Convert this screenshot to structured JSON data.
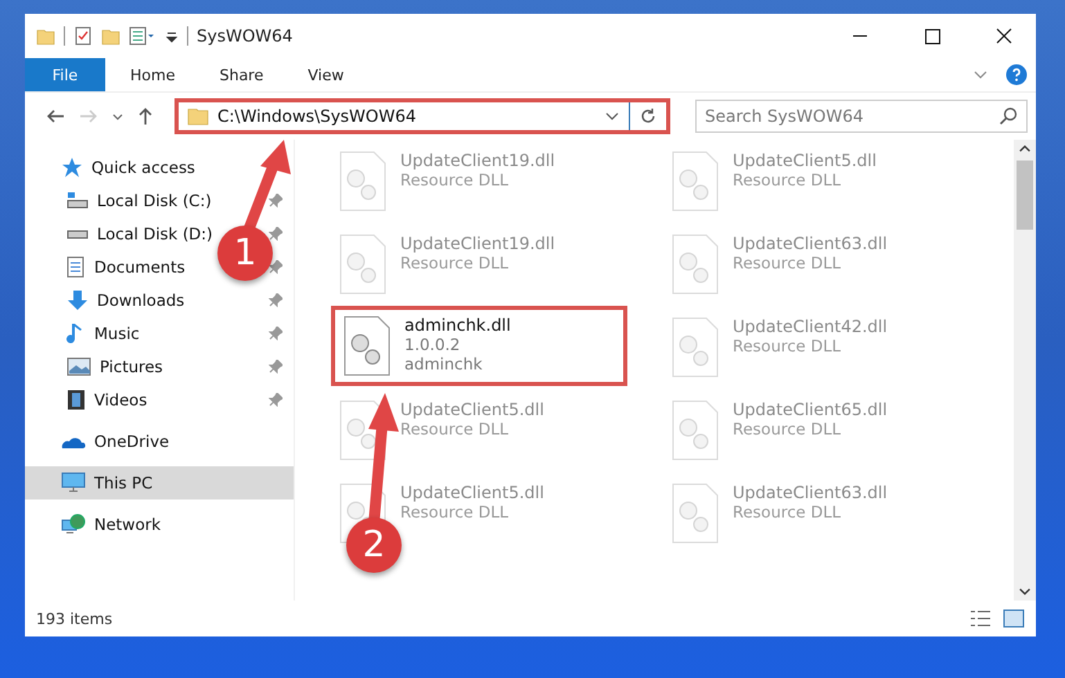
{
  "window": {
    "title": "SysWOW64"
  },
  "ribbon": {
    "tabs": [
      {
        "label": "File",
        "selected": true
      },
      {
        "label": "Home",
        "selected": false
      },
      {
        "label": "Share",
        "selected": false
      },
      {
        "label": "View",
        "selected": false
      }
    ]
  },
  "address": {
    "value": "C:\\Windows\\SysWOW64",
    "highlighted": true
  },
  "search": {
    "placeholder": "Search SysWOW64"
  },
  "sidebar": {
    "items": [
      {
        "label": "Quick access",
        "kind": "quick",
        "selected": false,
        "children": [
          {
            "label": "Local Disk (C:)",
            "kind": "disk-c",
            "pinned": true
          },
          {
            "label": "Local Disk (D:)",
            "kind": "disk",
            "pinned": true
          },
          {
            "label": "Documents",
            "kind": "documents",
            "pinned": true
          },
          {
            "label": "Downloads",
            "kind": "downloads",
            "pinned": true
          },
          {
            "label": "Music",
            "kind": "music",
            "pinned": true
          },
          {
            "label": "Pictures",
            "kind": "pictures",
            "pinned": true
          },
          {
            "label": "Videos",
            "kind": "videos",
            "pinned": true
          }
        ]
      },
      {
        "label": "OneDrive",
        "kind": "onedrive",
        "selected": false
      },
      {
        "label": "This PC",
        "kind": "pc",
        "selected": true
      },
      {
        "label": "Network",
        "kind": "network",
        "selected": false
      }
    ]
  },
  "files": [
    {
      "name": "UpdateClient19.dll",
      "line_2": "Resource DLL",
      "dimmed": true,
      "highlighted": false
    },
    {
      "name": "UpdateClient5.dll",
      "line_2": "Resource DLL",
      "dimmed": true,
      "highlighted": false
    },
    {
      "name": "UpdateClient19.dll",
      "line_2": "Resource DLL",
      "dimmed": true,
      "highlighted": false
    },
    {
      "name": "UpdateClient63.dll",
      "line_2": "Resource DLL",
      "dimmed": true,
      "highlighted": false
    },
    {
      "name": "adminchk.dll",
      "line_2": "1.0.0.2",
      "line_3": "adminchk",
      "dimmed": false,
      "highlighted": true
    },
    {
      "name": "UpdateClient42.dll",
      "line_2": "Resource DLL",
      "dimmed": true,
      "highlighted": false
    },
    {
      "name": "UpdateClient5.dll",
      "line_2": "Resource DLL",
      "dimmed": true,
      "highlighted": false
    },
    {
      "name": "UpdateClient65.dll",
      "line_2": "Resource DLL",
      "dimmed": true,
      "highlighted": false
    },
    {
      "name": "UpdateClient5.dll",
      "line_2": "Resource DLL",
      "dimmed": true,
      "highlighted": false
    },
    {
      "name": "UpdateClient63.dll",
      "line_2": "Resource DLL",
      "dimmed": true,
      "highlighted": false
    }
  ],
  "status_bar": {
    "count": "193 items"
  },
  "steps": [
    {
      "number": "1"
    },
    {
      "number": "2"
    }
  ]
}
